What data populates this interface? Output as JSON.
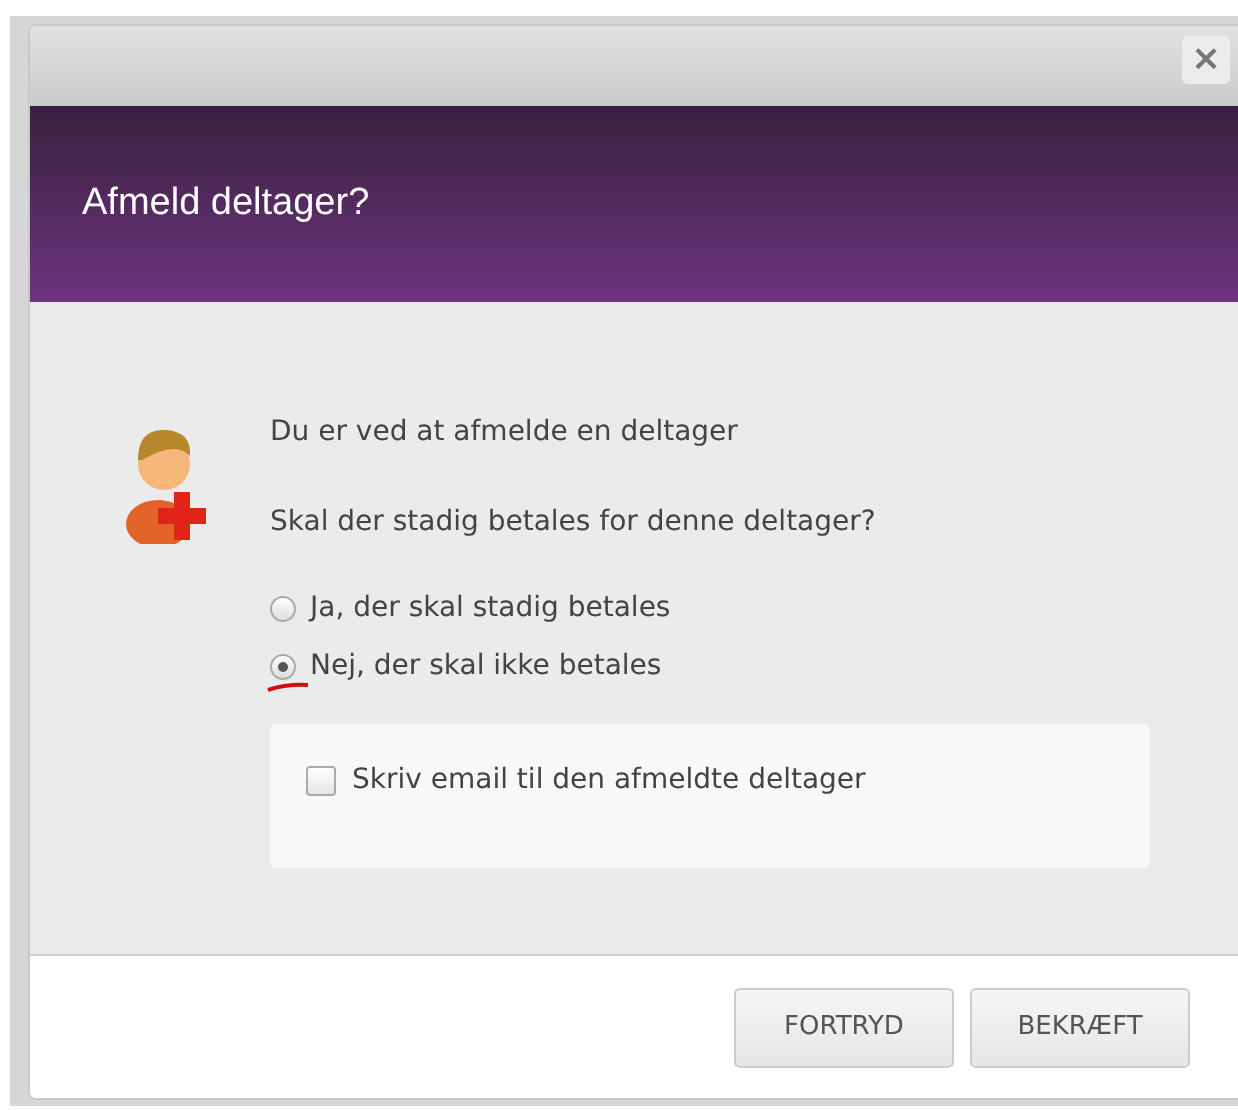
{
  "dialog": {
    "close_icon": "×",
    "title": "Afmeld deltager?",
    "message": "Du er ved at afmelde en deltager",
    "question": "Skal der stadig betales for denne deltager?",
    "payment_options": [
      {
        "label": "Ja, der skal stadig betales",
        "selected": false
      },
      {
        "label": "Nej, der skal ikke betales",
        "selected": true
      }
    ],
    "email_option": {
      "label": "Skriv email til den afmeldte deltager",
      "checked": false
    },
    "buttons": [
      {
        "label": "FORTRYD"
      },
      {
        "label": "BEKRÆFT"
      }
    ]
  }
}
